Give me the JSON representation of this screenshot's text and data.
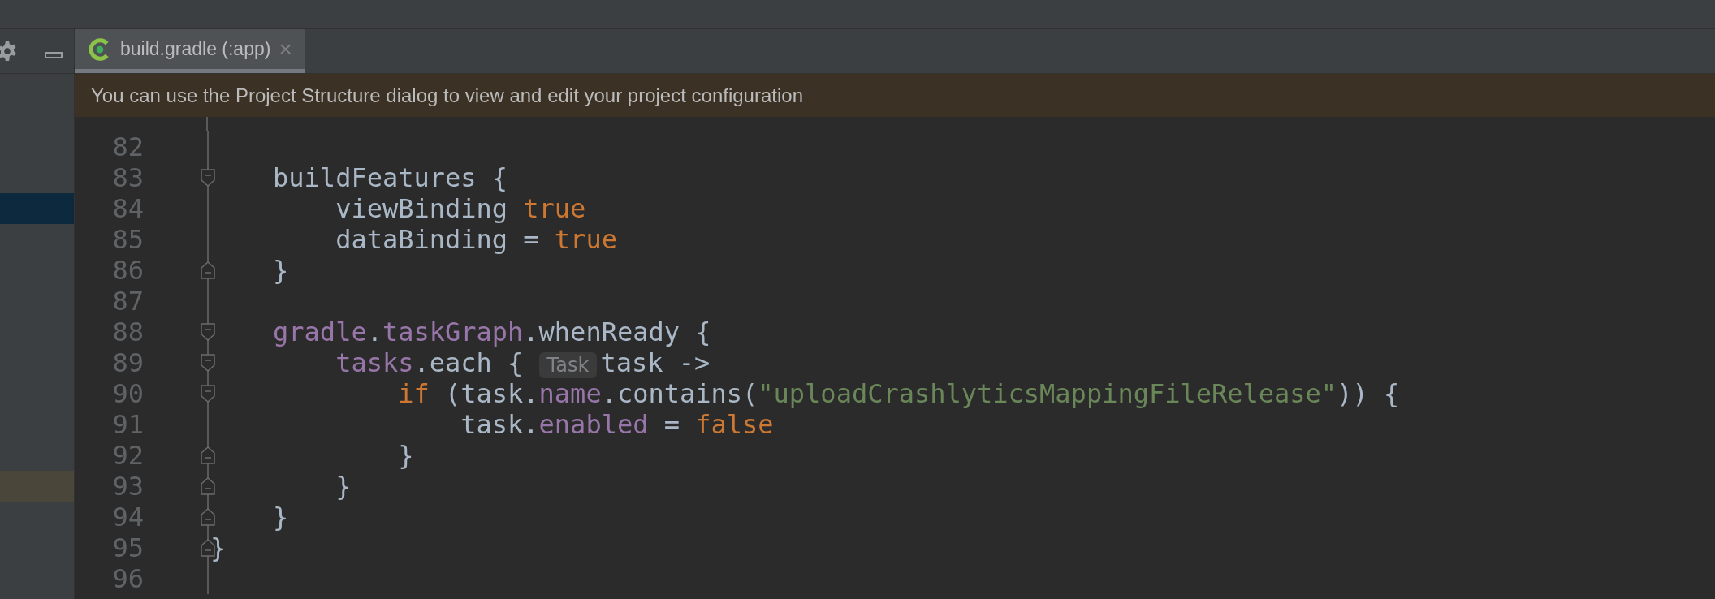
{
  "tabs": [
    {
      "label": "build.gradle (:app)",
      "close": "×",
      "selected": true
    }
  ],
  "banner": {
    "text": "You can use the Project Structure dialog to view and edit your project configuration"
  },
  "lines": [
    {
      "number": "82"
    },
    {
      "number": "83",
      "fold_open": true,
      "tokens": [
        {
          "kind": "plain",
          "text": "    buildFeatures {"
        }
      ]
    },
    {
      "number": "84",
      "selected": true,
      "tokens": [
        {
          "kind": "plain",
          "text": "        viewBinding "
        },
        {
          "kind": "keyword",
          "text": "true"
        }
      ]
    },
    {
      "number": "85",
      "tokens": [
        {
          "kind": "plain",
          "text": "        dataBinding = "
        },
        {
          "kind": "keyword",
          "text": "true"
        }
      ]
    },
    {
      "number": "86",
      "fold_close": true,
      "tokens": [
        {
          "kind": "plain",
          "text": "    }"
        }
      ]
    },
    {
      "number": "87"
    },
    {
      "number": "88",
      "fold_open": true,
      "tokens": [
        {
          "kind": "property",
          "text": "    gradle"
        },
        {
          "kind": "plain",
          "text": "."
        },
        {
          "kind": "property",
          "text": "taskGraph"
        },
        {
          "kind": "plain",
          "text": ".whenReady {"
        }
      ]
    },
    {
      "number": "89",
      "fold_open": true,
      "tokens": [
        {
          "kind": "property",
          "text": "        tasks"
        },
        {
          "kind": "plain",
          "text": ".each { "
        },
        {
          "kind": "hint",
          "text": "Task"
        },
        {
          "kind": "plain",
          "text": "task ->"
        }
      ]
    },
    {
      "number": "90",
      "fold_open": true,
      "tokens": [
        {
          "kind": "keyword",
          "text": "            if"
        },
        {
          "kind": "plain",
          "text": " (task."
        },
        {
          "kind": "property",
          "text": "name"
        },
        {
          "kind": "plain",
          "text": ".contains("
        },
        {
          "kind": "string",
          "text": "\"uploadCrashlyticsMappingFileRelease\""
        },
        {
          "kind": "plain",
          "text": ")) {"
        }
      ]
    },
    {
      "number": "91",
      "tokens": [
        {
          "kind": "plain",
          "text": "                task."
        },
        {
          "kind": "property",
          "text": "enabled"
        },
        {
          "kind": "plain",
          "text": " = "
        },
        {
          "kind": "keyword",
          "text": "false"
        }
      ]
    },
    {
      "number": "92",
      "fold_close": true,
      "tokens": [
        {
          "kind": "plain",
          "text": "            }"
        }
      ]
    },
    {
      "number": "93",
      "fold_close": true,
      "highlighted": true,
      "tokens": [
        {
          "kind": "plain",
          "text": "        }"
        }
      ]
    },
    {
      "number": "94",
      "fold_close": true,
      "tokens": [
        {
          "kind": "plain",
          "text": "    }"
        }
      ]
    },
    {
      "number": "95",
      "fold_close": true,
      "tokens": [
        {
          "kind": "plain",
          "text": "}"
        }
      ]
    },
    {
      "number": "96"
    }
  ]
}
